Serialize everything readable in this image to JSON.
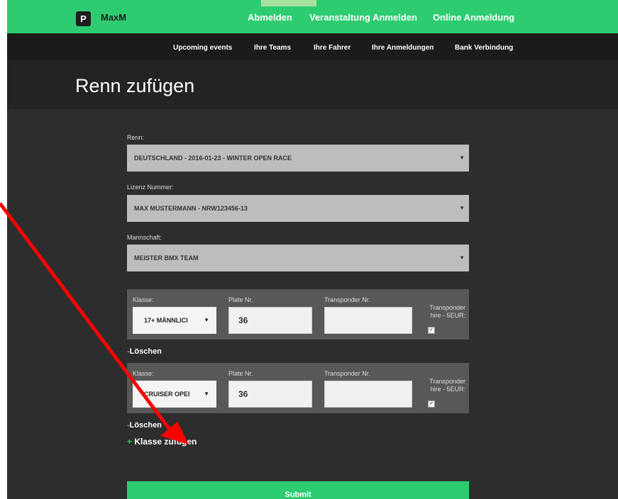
{
  "brand": {
    "logo_glyph": "P",
    "name": "MaxM"
  },
  "topnav": [
    "Abmelden",
    "Veranstaltung Anmelden",
    "Online Anmeldung"
  ],
  "subnav": [
    "Upcoming events",
    "Ihre Teams",
    "Ihre Fahrer",
    "Ihre Anmeldungen",
    "Bank Verbindung"
  ],
  "page_title": "Renn zufügen",
  "form": {
    "race": {
      "label": "Renn:",
      "value": "DEUTSCHLAND - 2016-01-23 - WINTER OPEN RACE"
    },
    "license": {
      "label": "Lizenz Nummer:",
      "value": "MAX MUSTERMANN - NRW123456-13"
    },
    "team": {
      "label": "Mannschaft:",
      "value": "MEISTER BMX TEAM"
    },
    "class_rows": [
      {
        "class_label": "Klasse:",
        "class_value": "17+ MÄNNLICI",
        "plate_label": "Plate Nr.",
        "plate_value": "36",
        "transponder_label": "Transponder Nr.",
        "transponder_value": "",
        "hire_label": "Transponder hire - 5EUR:",
        "hire_checked": true,
        "delete_label": "Löschen"
      },
      {
        "class_label": "Klasse:",
        "class_value": "CRUISER OPEI",
        "plate_label": "Plate Nr.",
        "plate_value": "36",
        "transponder_label": "Transponder Nr.",
        "transponder_value": "",
        "hire_label": "Transponder hire - 5EUR:",
        "hire_checked": true,
        "delete_label": "Löschen"
      }
    ],
    "minus_glyph": "-",
    "plus_glyph": "+",
    "add_class_label": "Klasse zufügen",
    "submit_label": "Submit",
    "caret_glyph": "▼",
    "check_glyph": "✓"
  },
  "colors": {
    "accent": "#2ecc71",
    "annotation_arrow": "#ff0000"
  }
}
